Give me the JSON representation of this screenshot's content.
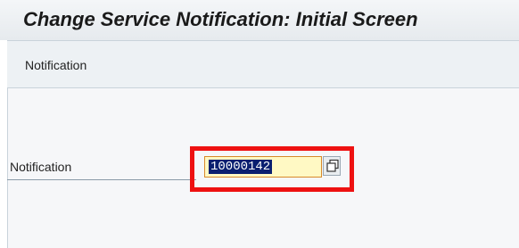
{
  "window": {
    "title": "Change Service Notification: Initial Screen"
  },
  "menu": {
    "items": [
      {
        "label": "Notification"
      }
    ]
  },
  "form": {
    "notification_label": "Notification",
    "notification_value": "10000142"
  },
  "icons": {
    "value_help": "copy-icon"
  },
  "colors": {
    "highlight": "#ee1111",
    "input_bg": "#fff9c4",
    "selection_bg": "#0a1f70"
  }
}
